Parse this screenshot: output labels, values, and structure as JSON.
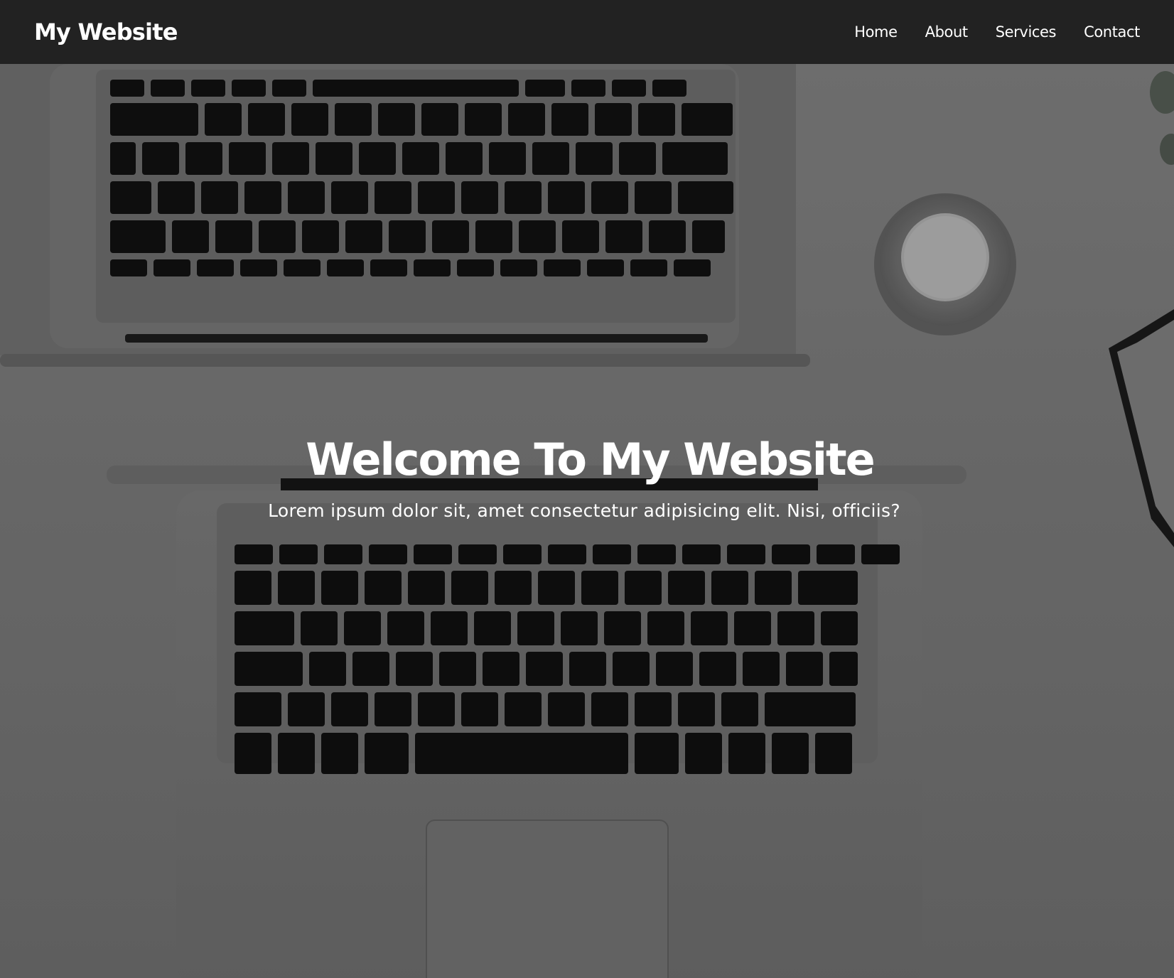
{
  "nav": {
    "brand": "My Website",
    "links": [
      "Home",
      "About",
      "Services",
      "Contact"
    ]
  },
  "hero": {
    "title": "Welcome To My Website",
    "subtitle": "Lorem ipsum dolor sit, amet consectetur adipisicing elit. Nisi, officiis?"
  },
  "colors": {
    "navbar": "#222222",
    "hero_text": "#ffffff",
    "overlay": "#000000"
  },
  "icons": {
    "background": "desk-laptops-photo"
  }
}
